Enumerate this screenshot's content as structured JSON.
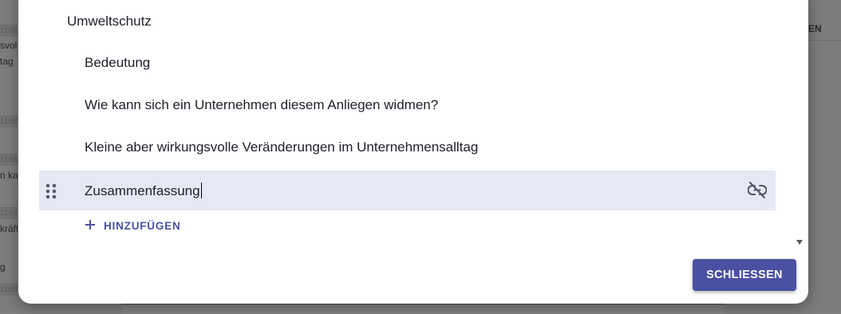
{
  "background": {
    "left_numbers": [
      "1188",
      "1188",
      "1188",
      "1188",
      "1188"
    ],
    "left_snippets": [
      "svoll",
      "tag",
      "n ka",
      "kräfte",
      "g"
    ],
    "right_header": "EN"
  },
  "dialog": {
    "root_item": "Umweltschutz",
    "sub_items": [
      "Bedeutung",
      "Wie kann sich ein Unternehmen diesem Anliegen widmen?",
      "Kleine aber wirkungsvolle Veränderungen im Unternehmensalltag"
    ],
    "active_item": "Zusammenfassung",
    "add_label": "HINZUFÜGEN",
    "close_label": "SCHLIESSEN",
    "icons": {
      "drag": "drag-handle-icon",
      "unlink": "unlink-icon",
      "add": "plus-icon",
      "scroll": "scroll-down-arrow-icon"
    },
    "colors": {
      "accent": "#4a51a3",
      "active_row": "#e6e9f4",
      "text": "#1e1e2a"
    }
  }
}
